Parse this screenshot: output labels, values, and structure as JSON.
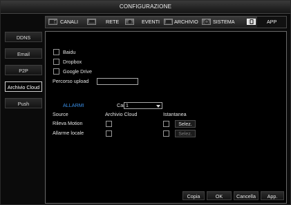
{
  "window": {
    "title": "CONFIGURAZIONE"
  },
  "topnav": {
    "items": [
      {
        "label": "CANALI",
        "icon": "camera-icon"
      },
      {
        "label": "RETE",
        "icon": "network-icon"
      },
      {
        "label": "EVENTI",
        "icon": "bell-icon"
      },
      {
        "label": "ARCHIVIO",
        "icon": "disk-icon"
      },
      {
        "label": "SISTEMA",
        "icon": "gear-icon"
      },
      {
        "label": "APP",
        "icon": "phone-icon",
        "active": true
      }
    ]
  },
  "sidebar": {
    "items": [
      {
        "label": "DDNS"
      },
      {
        "label": "Email"
      },
      {
        "label": "P2P"
      },
      {
        "label": "Archivio Cloud",
        "active": true
      },
      {
        "label": "Push"
      }
    ]
  },
  "cloud": {
    "providers": [
      {
        "label": "Baidu",
        "checked": false
      },
      {
        "label": "Dropbox",
        "checked": false
      },
      {
        "label": "Google Drive",
        "checked": false
      }
    ],
    "upload_path_label": "Percorso upload",
    "upload_path_value": ""
  },
  "alarms": {
    "title": "ALLARMI",
    "channels_label": "Canali",
    "channels_value": "1",
    "headers": {
      "source": "Source",
      "cloud": "Archivio Cloud",
      "snapshot": "Istantanea"
    },
    "rows": [
      {
        "label": "Rileva Motion",
        "cloud": false,
        "snapshot": false,
        "select_label": "Selez.",
        "select_enabled": true
      },
      {
        "label": "Allarme locale",
        "cloud": false,
        "snapshot": false,
        "select_label": "Selez.",
        "select_enabled": false
      }
    ]
  },
  "footer": {
    "copy": "Copia",
    "ok": "OK",
    "cancel": "Cancella",
    "apply": "App."
  },
  "colors": {
    "accent": "#3a8fe6",
    "background": "#000000",
    "frame": "#c9c9c9"
  }
}
